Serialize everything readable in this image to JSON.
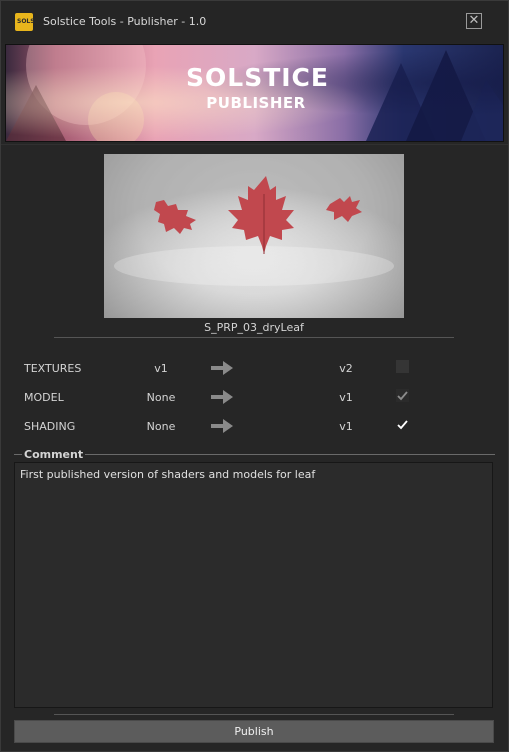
{
  "window": {
    "title": "Solstice Tools - Publisher - 1.0",
    "app_icon_text": "SOLS",
    "close_label": "✕"
  },
  "banner": {
    "logo_line1": "SOLSTICE",
    "logo_line2": "PUBLISHER"
  },
  "preview": {
    "asset_name": "S_PRP_03_dryLeaf",
    "leaf_color": "#c1484e"
  },
  "publish_rows": [
    {
      "label": "TEXTURES",
      "from": "v1",
      "to": "v2",
      "checked": false,
      "enabled": false
    },
    {
      "label": "MODEL",
      "from": "None",
      "to": "v1",
      "checked": true,
      "enabled": false
    },
    {
      "label": "SHADING",
      "from": "None",
      "to": "v1",
      "checked": true,
      "enabled": true
    }
  ],
  "comment": {
    "legend": "Comment",
    "text": "First published version of shaders and models for leaf"
  },
  "footer": {
    "publish_label": "Publish"
  },
  "colors": {
    "window_bg": "#262626",
    "button_bg": "#5c5c5c",
    "accent_gold": "#e8b51c"
  }
}
